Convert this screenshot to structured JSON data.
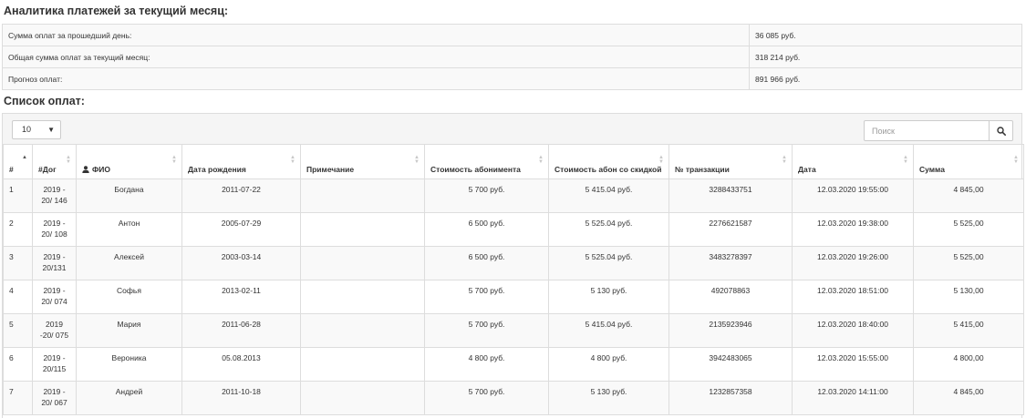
{
  "analytics": {
    "title": "Аналитика платежей за текущий месяц:",
    "rows": [
      {
        "label": "Сумма оплат за прошедший день:",
        "value": "36 085 руб."
      },
      {
        "label": "Общая сумма оплат за текущий месяц:",
        "value": "318 214 руб."
      },
      {
        "label": "Прогноз оплат:",
        "value": "891 966 руб."
      }
    ]
  },
  "list": {
    "title": "Список оплат:",
    "page_length": "10",
    "search_placeholder": "Поиск",
    "columns": [
      "#",
      "#Дог",
      "ФИО",
      "Дата рождения",
      "Примечание",
      "Стоимость абонимента",
      "Стоимость абон со скидкой",
      "№ транзакции",
      "Дата",
      "Сумма"
    ],
    "rows": [
      [
        "1",
        "2019 - 20/ 146",
        "Богдана",
        "2011-07-22",
        "",
        "5 700 руб.",
        "5 415.04 руб.",
        "3288433751",
        "12.03.2020 19:55:00",
        "4 845,00"
      ],
      [
        "2",
        "2019 - 20/ 108",
        "Антон",
        "2005-07-29",
        "",
        "6 500 руб.",
        "5 525.04 руб.",
        "2276621587",
        "12.03.2020 19:38:00",
        "5 525,00"
      ],
      [
        "3",
        "2019 - 20/131",
        "Алексей",
        "2003-03-14",
        "",
        "6 500 руб.",
        "5 525.04 руб.",
        "3483278397",
        "12.03.2020 19:26:00",
        "5 525,00"
      ],
      [
        "4",
        "2019 - 20/ 074",
        "Софья",
        "2013-02-11",
        "",
        "5 700 руб.",
        "5 130 руб.",
        "492078863",
        "12.03.2020 18:51:00",
        "5 130,00"
      ],
      [
        "5",
        "2019 -20/ 075",
        "Мария",
        "2011-06-28",
        "",
        "5 700 руб.",
        "5 415.04 руб.",
        "2135923946",
        "12.03.2020 18:40:00",
        "5 415,00"
      ],
      [
        "6",
        "2019 - 20/115",
        "Вероника",
        "05.08.2013",
        "",
        "4 800 руб.",
        "4 800 руб.",
        "3942483065",
        "12.03.2020 15:55:00",
        "4 800,00"
      ],
      [
        "7",
        "2019 - 20/ 067",
        "Андрей",
        "2011-10-18",
        "",
        "5 700 руб.",
        "5 130 руб.",
        "1232857358",
        "12.03.2020 14:11:00",
        "4 845,00"
      ]
    ]
  }
}
